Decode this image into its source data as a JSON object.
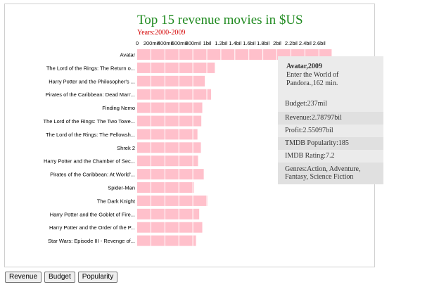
{
  "chart_data": {
    "type": "bar",
    "orientation": "horizontal",
    "title": "Top 15 revenue movies in $US",
    "subtitle": "Years:2000-2009",
    "x_ticks": [
      "0",
      "200mil",
      "400mil",
      "600mil",
      "800mil",
      "1bil",
      "1.2bil",
      "1.4bil",
      "1.6bil",
      "1.8bil",
      "2bil",
      "2.2bil",
      "2.4bil",
      "2.6bil"
    ],
    "xlim": [
      0,
      2.8
    ],
    "categories": [
      "Avatar",
      "The Lord of the Rings: The Return o...",
      "Harry Potter and the Philosopher's ...",
      "Pirates of the Caribbean: Dead Man'...",
      "Finding Nemo",
      "The Lord of the Rings: The Two Towe...",
      "The Lord of the Rings: The Fellowsh...",
      "Shrek 2",
      "Harry Potter and the Chamber of Sec...",
      "Pirates of the Caribbean: At World'...",
      "Spider-Man",
      "The Dark Knight",
      "Harry Potter and the Goblet of Fire...",
      "Harry Potter and the Order of the P...",
      "Star Wars: Episode III - Revenge of..."
    ],
    "values": [
      2.788,
      1.119,
      0.976,
      1.066,
      0.94,
      0.926,
      0.871,
      0.92,
      0.879,
      0.961,
      0.822,
      1.005,
      0.896,
      0.94,
      0.85
    ],
    "bar_color": "#ffc0cb",
    "grid": false
  },
  "tooltip": {
    "title": "Avatar,2009",
    "tagline": "Enter the World of Pandora.,162 min.",
    "rows": [
      "Budget:237mil",
      "Revenue:2.78797bil",
      "Profit:2.55097bil",
      "TMDB Popularity:185",
      "IMDB Rating:7.2",
      "Genres:Action, Adventure, Fantasy, Science Fiction"
    ]
  },
  "buttons": {
    "revenue": "Revenue",
    "budget": "Budget",
    "popularity": "Popularity"
  }
}
